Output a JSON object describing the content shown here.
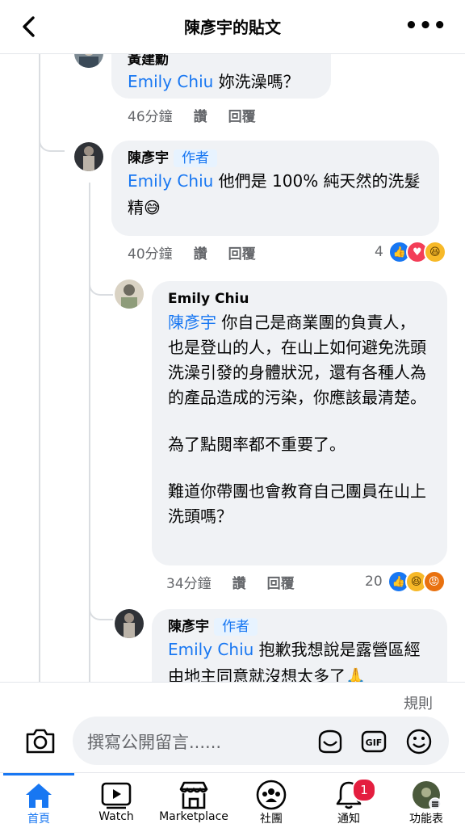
{
  "header": {
    "title": "陳彥宇的貼文"
  },
  "comments": [
    {
      "name": "黃建勳",
      "mention": "Emily Chiu",
      "text": " 妳洗澡嗎？",
      "time": "46分鐘",
      "like_label": "讚",
      "reply_label": "回覆"
    },
    {
      "name": "陳彥宇",
      "badge": "作者",
      "mention": "Emily Chiu",
      "text": " 他們是 100% 純天然的洗髮精😅",
      "time": "40分鐘",
      "like_label": "讚",
      "reply_label": "回覆",
      "reaction_count": "4"
    },
    {
      "name": "Emily Chiu",
      "mention": "陳彥宇",
      "text": " 你自己是商業團的負責人，也是登山的人，在山上如何避免洗頭洗澡引發的身體狀況，還有各種人為的產品造成的污染，你應該最清楚。",
      "para2": "為了點閱率都不重要了。",
      "para3": "難道你帶團也會教育自己團員在山上洗頭嗎？",
      "time": "34分鐘",
      "like_label": "讚",
      "reply_label": "回覆",
      "reaction_count": "20"
    },
    {
      "name": "陳彥宇",
      "badge": "作者",
      "mention": "Emily Chiu",
      "text": " 抱歉我想說是露營區經由地主同意就沒想太多了🙏"
    }
  ],
  "composer": {
    "rules_label": "規則",
    "placeholder": "撰寫公開留言......"
  },
  "tabs": [
    {
      "label": "首頁",
      "icon": "home-icon"
    },
    {
      "label": "Watch",
      "icon": "watch-icon"
    },
    {
      "label": "Marketplace",
      "icon": "marketplace-icon"
    },
    {
      "label": "社團",
      "icon": "groups-icon"
    },
    {
      "label": "通知",
      "icon": "bell-icon",
      "badge": "1"
    },
    {
      "label": "功能表",
      "icon": "menu-avatar-icon"
    }
  ],
  "colors": {
    "accent": "#1877f2",
    "bubble": "#f0f2f5",
    "notification": "#e41e3f"
  }
}
